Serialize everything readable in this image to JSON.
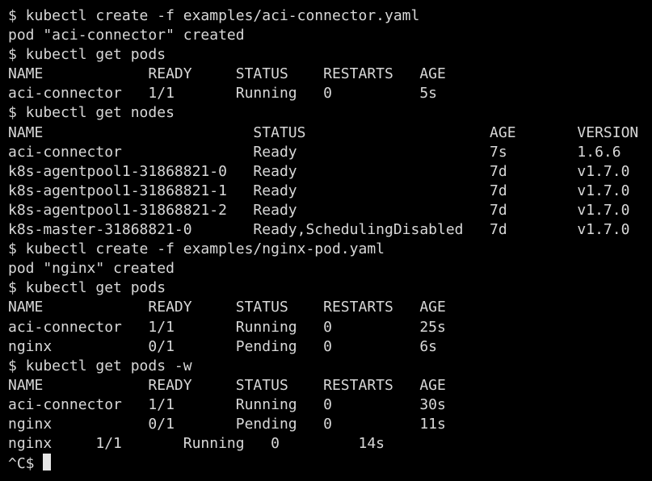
{
  "terminal": {
    "lines": [
      "$ kubectl create -f examples/aci-connector.yaml",
      "pod \"aci-connector\" created",
      "$ kubectl get pods",
      "NAME            READY     STATUS    RESTARTS   AGE",
      "aci-connector   1/1       Running   0          5s",
      "$ kubectl get nodes",
      "NAME                        STATUS                     AGE       VERSION",
      "aci-connector               Ready                      7s        1.6.6",
      "k8s-agentpool1-31868821-0   Ready                      7d        v1.7.0",
      "k8s-agentpool1-31868821-1   Ready                      7d        v1.7.0",
      "k8s-agentpool1-31868821-2   Ready                      7d        v1.7.0",
      "k8s-master-31868821-0       Ready,SchedulingDisabled   7d        v1.7.0",
      "$ kubectl create -f examples/nginx-pod.yaml",
      "pod \"nginx\" created",
      "$ kubectl get pods",
      "NAME            READY     STATUS    RESTARTS   AGE",
      "aci-connector   1/1       Running   0          25s",
      "nginx           0/1       Pending   0          6s",
      "$ kubectl get pods -w",
      "NAME            READY     STATUS    RESTARTS   AGE",
      "aci-connector   1/1       Running   0          30s",
      "nginx           0/1       Pending   0          11s",
      "nginx     1/1       Running   0         14s"
    ],
    "prompt": "^C$ "
  },
  "colors": {
    "background": "#000000",
    "foreground": "#d8d8d8",
    "cursor": "#e6e6e6"
  }
}
